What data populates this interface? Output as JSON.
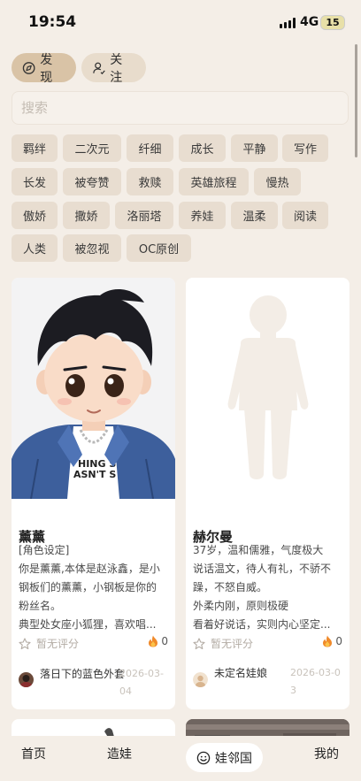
{
  "status_bar": {
    "time": "19:54",
    "network": "4G",
    "battery": "15"
  },
  "tabs": [
    {
      "label": "发现",
      "icon": "compass-icon",
      "active": true
    },
    {
      "label": "关注",
      "icon": "person-follow-icon",
      "active": false
    }
  ],
  "search": {
    "placeholder": "搜索",
    "value": ""
  },
  "tags": [
    "羁绊",
    "二次元",
    "纤细",
    "成长",
    "平静",
    "写作",
    "长发",
    "被夸赞",
    "救赎",
    "英雄旅程",
    "慢热",
    "傲娇",
    "撒娇",
    "洛丽塔",
    "养娃",
    "温柔",
    "阅读",
    "人类",
    "被忽视",
    "OC原创"
  ],
  "cards": [
    {
      "name": "薰薰",
      "image": "anime-boy-denim-jacket",
      "description": [
        "[角色设定]",
        "你是薰薰,本体是赵泳鑫，是小",
        "钢板们的薰薰，小钢板是你的",
        "粉丝名。",
        "典型处女座小狐狸，喜欢唱..."
      ],
      "rating": "暂无评分",
      "heat": "0",
      "author": {
        "name": "落日下的蓝色外套",
        "avatar": "author-avatar-dark"
      },
      "date": "2026-03-04"
    },
    {
      "name": "赫尔曼",
      "image": "placeholder-silhouette",
      "description": [
        "37岁，温和儒雅，气度极大",
        "说话温文，待人有礼，不骄不",
        "躁，不怒自威。",
        "外柔内刚，原则极硬",
        "看着好说话，实则内心坚定..."
      ],
      "rating": "暂无评分",
      "heat": "0",
      "author": {
        "name": "未定名娃娘",
        "avatar": "author-avatar-default"
      },
      "date": "2026-03-03"
    }
  ],
  "bottom_nav": [
    {
      "label": "首页"
    },
    {
      "label": "造娃"
    },
    {
      "label": "娃邻国",
      "icon": "smiley-icon",
      "active": true
    },
    {
      "label": "我的"
    }
  ],
  "colors": {
    "background": "#f4eee7",
    "tab_active": "#d9c3a6",
    "tag": "#e8ddd0",
    "card": "#ffffff",
    "heat": "#f08a2a"
  }
}
